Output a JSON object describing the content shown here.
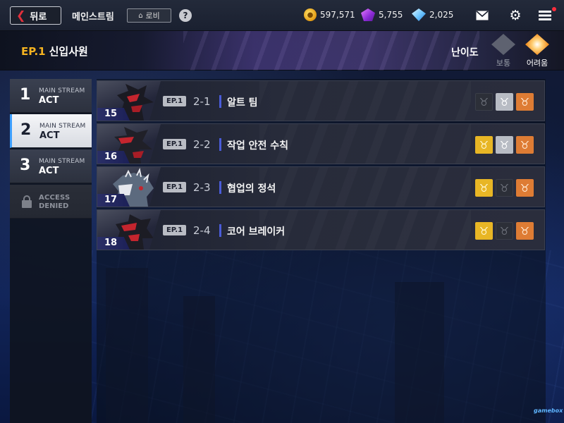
{
  "colors": {
    "accent": "#f5b320",
    "active_tab_bar": "#3fa0ff",
    "stage_separator": "#4a5cd8",
    "medal_gold": "#e8b625",
    "medal_silver": "#b8bcc4",
    "medal_bronze": "#de7c34",
    "notification_dot": "#ff2d3c"
  },
  "topbar": {
    "back_label": "뒤로",
    "title": "메인스트림",
    "lobby_label": "로비",
    "help_label": "?",
    "currencies": [
      {
        "icon": "gold-coin-icon",
        "value": "597,571"
      },
      {
        "icon": "purple-crystal-icon",
        "value": "5,755"
      },
      {
        "icon": "blue-diamond-icon",
        "value": "2,025"
      }
    ]
  },
  "header": {
    "episode_num": "EP.1",
    "episode_title": "신입사원",
    "difficulty_label": "난이도",
    "difficulties": [
      {
        "label": "보통",
        "selected": false
      },
      {
        "label": "어려움",
        "selected": true
      }
    ]
  },
  "acts": [
    {
      "number": "1",
      "sub": "MAIN STREAM",
      "label": "ACT",
      "active": false,
      "locked": false
    },
    {
      "number": "2",
      "sub": "MAIN STREAM",
      "label": "ACT",
      "active": true,
      "locked": false
    },
    {
      "number": "3",
      "sub": "MAIN STREAM",
      "label": "ACT",
      "active": false,
      "locked": false
    },
    {
      "number": "",
      "sub": "ACCESS",
      "label": "DENIED",
      "active": false,
      "locked": true
    }
  ],
  "stages": [
    {
      "number": "15",
      "ep": "EP.1",
      "code": "2-1",
      "name": "알트 팀",
      "medals": [
        "off",
        "silver",
        "bronze"
      ]
    },
    {
      "number": "16",
      "ep": "EP.1",
      "code": "2-2",
      "name": "작업 안전 수칙",
      "medals": [
        "gold",
        "silver",
        "bronze"
      ]
    },
    {
      "number": "17",
      "ep": "EP.1",
      "code": "2-3",
      "name": "협업의 정석",
      "medals": [
        "gold",
        "off",
        "bronze"
      ]
    },
    {
      "number": "18",
      "ep": "EP.1",
      "code": "2-4",
      "name": "코어 브레이커",
      "medals": [
        "gold",
        "off",
        "bronze"
      ]
    }
  ],
  "footer": {
    "logo": "gamebox"
  }
}
